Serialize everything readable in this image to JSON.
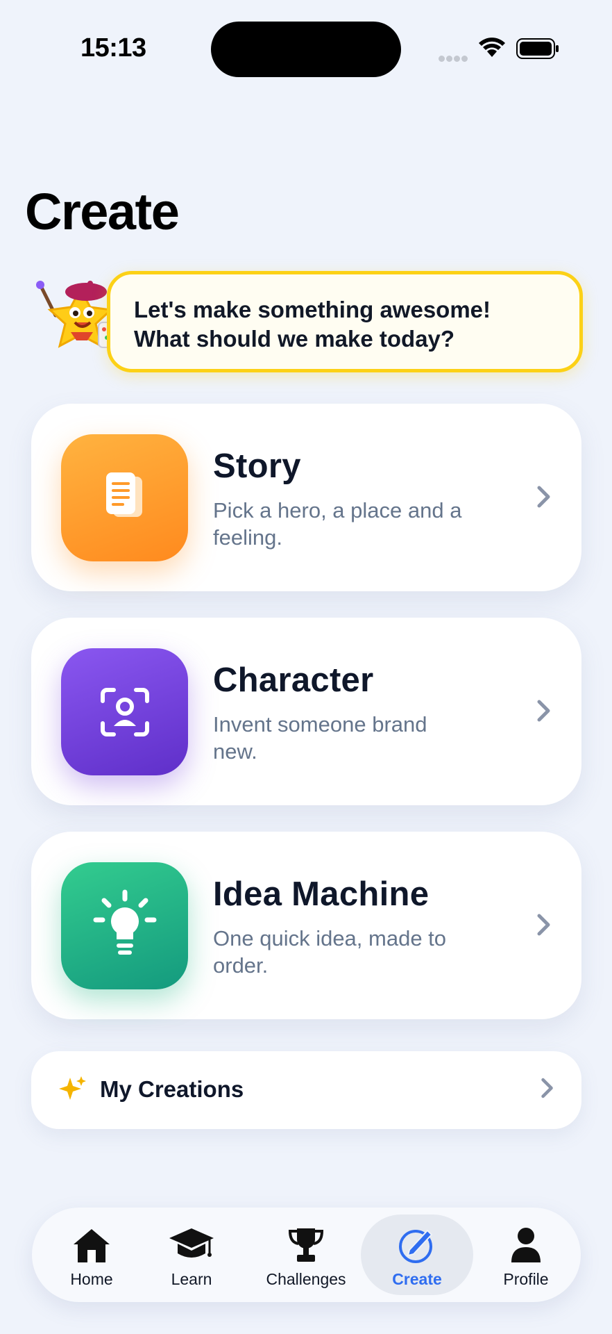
{
  "status_bar": {
    "time": "15:13"
  },
  "page": {
    "title": "Create"
  },
  "mascot": {
    "icon": "paint-mascot-icon",
    "speech_line1": "Let's make something awesome!",
    "speech_line2": "What should we make today?"
  },
  "cards": [
    {
      "title": "Story",
      "description": "Pick a hero, a place and a feeling.",
      "icon": "document-icon",
      "color": "#ff9a2a"
    },
    {
      "title": "Character",
      "description": "Invent someone brand new.",
      "icon": "person-scan-icon",
      "color": "#7443de"
    },
    {
      "title": "Idea Machine",
      "description": "One quick idea, made to order.",
      "icon": "lightbulb-icon",
      "color": "#22b487"
    }
  ],
  "creations": {
    "label": "My Creations",
    "icon": "sparkle-icon",
    "icon_color": "#f5b400"
  },
  "tab_bar": {
    "active_color": "#2f6df0",
    "tabs": [
      {
        "label": "Home",
        "icon": "house-icon"
      },
      {
        "label": "Learn",
        "icon": "graduation-cap-icon"
      },
      {
        "label": "Challenges",
        "icon": "trophy-icon"
      },
      {
        "label": "Create",
        "icon": "pencil-circle-icon",
        "active": true
      },
      {
        "label": "Profile",
        "icon": "person-icon"
      }
    ]
  }
}
